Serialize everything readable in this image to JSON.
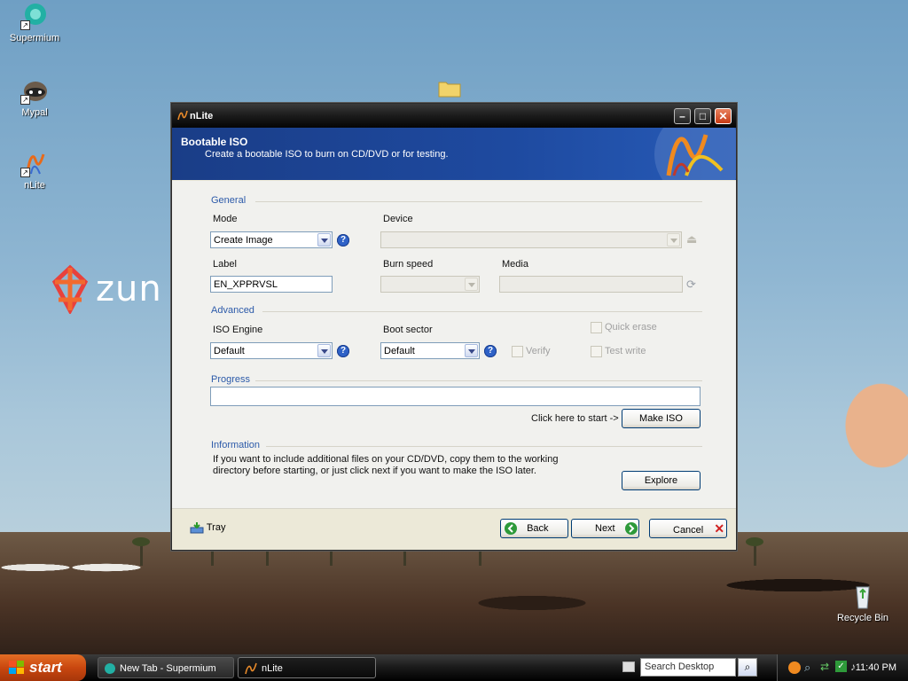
{
  "desktop": {
    "icons": [
      {
        "label": "Supermium"
      },
      {
        "label": "Mypal"
      },
      {
        "label": "nLite"
      },
      {
        "label": "Recycle Bin"
      }
    ],
    "wallpaper_logo_text": "zun"
  },
  "window": {
    "title": "nLite",
    "banner": {
      "heading": "Bootable ISO",
      "subtitle": "Create a bootable ISO to burn on CD/DVD or for testing."
    },
    "general": {
      "section_label": "General",
      "mode_label": "Mode",
      "mode_value": "Create Image",
      "device_label": "Device",
      "device_value": "",
      "label_label": "Label",
      "label_value": "EN_XPPRVSL",
      "burn_speed_label": "Burn speed",
      "media_label": "Media"
    },
    "advanced": {
      "section_label": "Advanced",
      "iso_engine_label": "ISO Engine",
      "iso_engine_value": "Default",
      "boot_sector_label": "Boot sector",
      "boot_sector_value": "Default",
      "verify_label": "Verify",
      "quick_erase_label": "Quick erase",
      "test_write_label": "Test write"
    },
    "progress": {
      "section_label": "Progress",
      "hint": "Click here to start ->",
      "make_iso_label": "Make ISO"
    },
    "information": {
      "section_label": "Information",
      "text": "If you want to include additional files on your CD/DVD, copy them to the working directory before starting, or just click next if you want to make the ISO later.",
      "explore_label": "Explore"
    },
    "footer": {
      "tray_label": "Tray",
      "back_label": "Back",
      "next_label": "Next",
      "cancel_label": "Cancel"
    }
  },
  "taskbar": {
    "start_label": "start",
    "tasks": [
      {
        "label": "New Tab - Supermium"
      },
      {
        "label": "nLite"
      }
    ],
    "search_placeholder": "Search Desktop",
    "clock": "11:40 PM"
  },
  "colors": {
    "banner": "#1e4aa0",
    "section_label": "#2c5aa9",
    "start_button": "#c9470f"
  }
}
